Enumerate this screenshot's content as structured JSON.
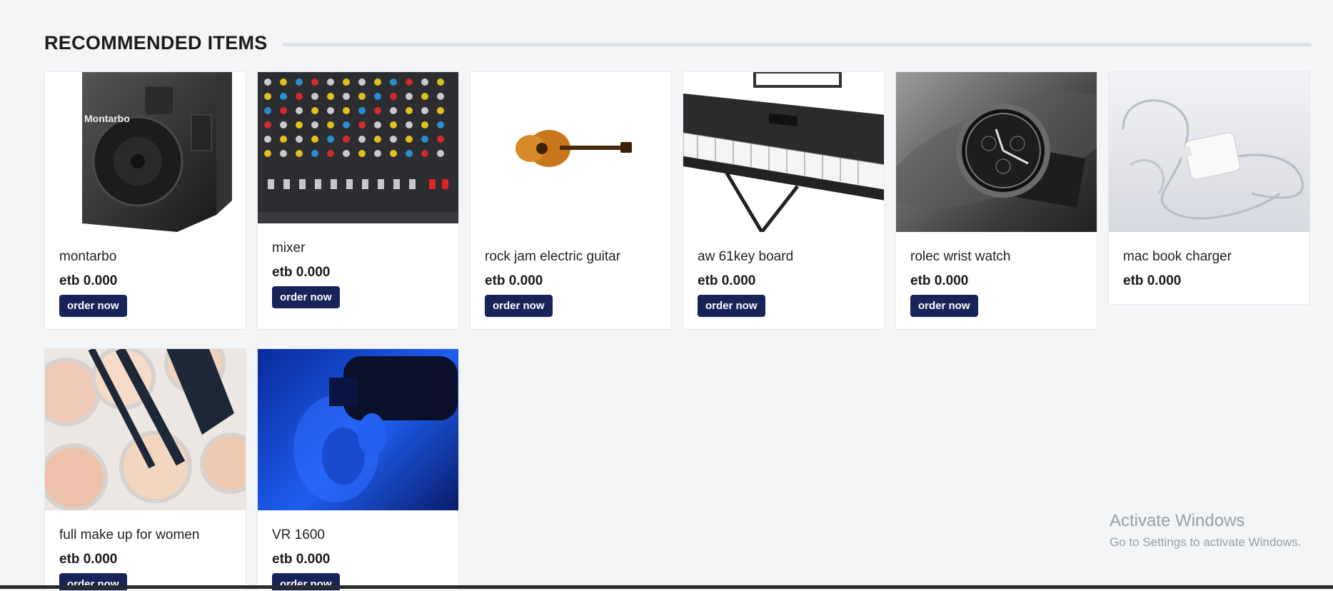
{
  "section": {
    "title": "RECOMMENDED ITEMS"
  },
  "products": [
    {
      "name": "montarbo",
      "price": "etb 0.000",
      "button": "order now",
      "image_icon": "speaker-image",
      "brand_text": "Montarbo"
    },
    {
      "name": "mixer",
      "price": "etb 0.000",
      "button": "order now",
      "image_icon": "mixer-image"
    },
    {
      "name": "rock jam electric guitar",
      "price": "etb 0.000",
      "button": "order now",
      "image_icon": "guitar-image"
    },
    {
      "name": "aw 61key board",
      "price": "etb 0.000",
      "button": "order now",
      "image_icon": "keyboard-image"
    },
    {
      "name": "rolec wrist watch",
      "price": "etb 0.000",
      "button": "order now",
      "image_icon": "watch-image"
    },
    {
      "name": "mac book charger",
      "price": "etb 0.000",
      "image_icon": "charger-image"
    },
    {
      "name": "full make up for women",
      "price": "etb 0.000",
      "button": "order now",
      "image_icon": "makeup-image"
    },
    {
      "name": "VR 1600",
      "price": "etb 0.000",
      "button": "order now",
      "image_icon": "vr-headset-image"
    }
  ],
  "watermark": {
    "title": "Activate Windows",
    "subtitle": "Go to Settings to activate Windows."
  },
  "colors": {
    "background": "#f4f5f7",
    "button": "#18235a",
    "card_border": "#e6e8ec"
  }
}
